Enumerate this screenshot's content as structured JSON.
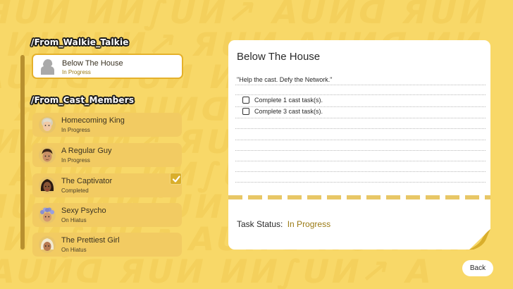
{
  "headings": {
    "walkie": "/From_Walkie_Talkie",
    "cast": "/From_Cast_Members"
  },
  "walkie_items": [
    {
      "title": "Below The House",
      "status": "In Progress",
      "icon": "silhouette-avatar-icon"
    }
  ],
  "cast_items": [
    {
      "title": "Homecoming King",
      "status": "In Progress",
      "icon": "homecoming-king-avatar-icon"
    },
    {
      "title": "A Regular Guy",
      "status": "In Progress",
      "icon": "regular-guy-avatar-icon"
    },
    {
      "title": "The Captivator",
      "status": "Completed",
      "icon": "captivator-avatar-icon",
      "checked": true
    },
    {
      "title": "Sexy Psycho",
      "status": "On Hiatus",
      "icon": "sexy-psycho-avatar-icon"
    },
    {
      "title": "The Prettiest Girl",
      "status": "On Hiatus",
      "icon": "prettiest-girl-avatar-icon"
    }
  ],
  "detail": {
    "title": "Below The House",
    "quote": "\"Help the cast. Defy the Network.\"",
    "tasks": [
      {
        "label": "Complete 1 cast task(s).",
        "done": false
      },
      {
        "label": "Complete 3 cast task(s).",
        "done": false
      }
    ],
    "status_label": "Task Status:",
    "status_value": "In Progress"
  },
  "back_label": "Back",
  "colors": {
    "background": "#f8d868",
    "accent": "#e5b12a",
    "status_text": "#9a7a14"
  }
}
